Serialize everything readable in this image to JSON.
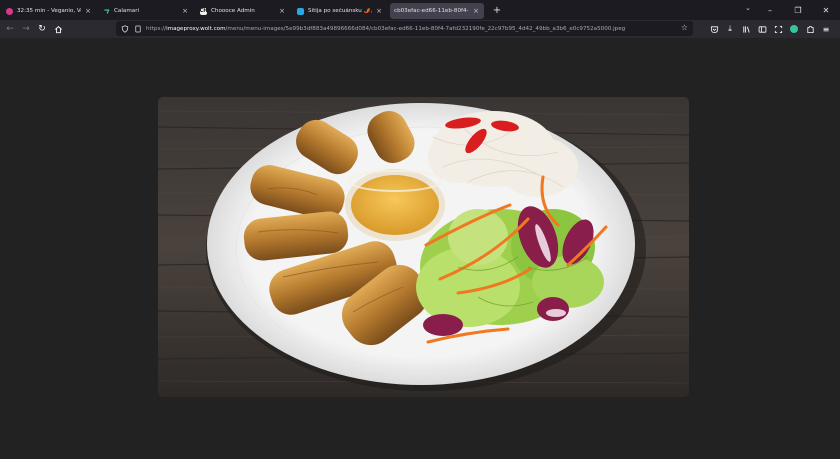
{
  "tabs": [
    {
      "title": "32:35 min - Veganio, Veganio -",
      "favicon": "pink-circle-icon",
      "active": false
    },
    {
      "title": "Calamari",
      "favicon": "teal-c-icon",
      "active": false
    },
    {
      "title": "Choooce Admin",
      "favicon": "choooce-icon",
      "favicon_text": "CH",
      "active": false
    },
    {
      "title": "Sitija po sečuánsku 🌶️🌶️🌶️ (1...",
      "favicon": "wolt-icon",
      "active": false
    },
    {
      "title": "cb03efac-ed66-11eb-80f4-7afd2",
      "favicon": "",
      "active": true
    }
  ],
  "url": {
    "prefix": "https://",
    "host": "imageproxy.wolt.com",
    "path": "/menu/menu-images/5e99b3df883a49896666d084/cb03efac-ed66-11eb-80f4-7afd232190fe_22c97b95_4d42_49bb_a3b6_e0c9752a5000.jpeg"
  },
  "colors": {
    "accent": "#37c5a0",
    "toolbar": "#2b2a33",
    "tabbar": "#1c1b22",
    "viewer": "#222222"
  }
}
